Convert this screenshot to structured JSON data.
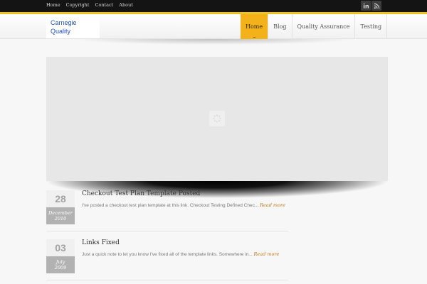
{
  "topbar": {
    "links": [
      "Home",
      "Copyright",
      "Contact",
      "About"
    ],
    "social": [
      {
        "icon": "linkedin-icon",
        "label": "in"
      },
      {
        "icon": "rss-icon"
      }
    ]
  },
  "header": {
    "logo_line1": "Carnegie",
    "logo_line2": "Quality",
    "nav": [
      "Home",
      "Blog",
      "Quality Assurance",
      "Testing"
    ],
    "active": "Home"
  },
  "colors": {
    "accent": "#f3b21a",
    "stripe": "#f2c21c",
    "logo_text": "#2550b8",
    "read_more": "#c07a1a"
  },
  "posts": [
    {
      "day": "28",
      "month": "December",
      "year": "2010",
      "title": "Checkout Test Plan Template Posted",
      "excerpt": "I've posted a checkout test plan template at this link. Checkout Testing Defined Chec...",
      "read_more": "Read more"
    },
    {
      "day": "03",
      "month": "July",
      "year": "2009",
      "title": "Links Fixed",
      "excerpt": "Just a quick note to let you know I've fixed all of the template links. Somewhere in...",
      "read_more": "Read more"
    }
  ]
}
